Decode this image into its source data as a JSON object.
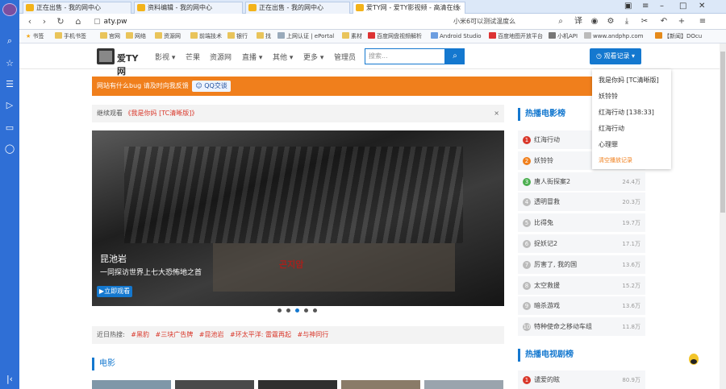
{
  "colors": {
    "accent": "#1478cf",
    "banner": "#f07f1c",
    "hot": "#d9372a"
  },
  "browser": {
    "tabs": [
      {
        "label": "正在出售 - 我的网中心",
        "active": false
      },
      {
        "label": "资料编辑 - 我的网中心",
        "active": false
      },
      {
        "label": "正在出售 - 我的网中心",
        "active": false
      },
      {
        "label": "爱TY网 - 爱TY影视频 - 高清在线",
        "active": true
      }
    ],
    "url": "aty.pw",
    "search": "小米6可以测试温度么",
    "bookmarks": [
      "书签",
      "手机书签",
      "官网",
      "网络",
      "资源网",
      "前端技术",
      "银行",
      "找",
      "上网认证 | ePortal",
      "素材",
      "百度网盘视频解析",
      "Android Studio",
      "百度地图开放平台",
      "小机API",
      "www.andphp.com",
      "【新闻】DOcu"
    ],
    "toolbar_icons": [
      "translate-icon",
      "game-icon",
      "download-icon",
      "scissors-icon",
      "undo-icon",
      "add-icon"
    ]
  },
  "site": {
    "logo_text": "爱TY网",
    "nav": [
      "影视 ▾",
      "芒果",
      "资源网",
      "直播 ▾",
      "其他 ▾",
      "更多 ▾",
      "管理员"
    ],
    "search_placeholder": "搜索...",
    "history_button": "观看记录 ▾",
    "banner_text": "网站有什么bug 请及时向我反馈",
    "banner_qq": "QQ交谈",
    "continue_prefix": "继续观看",
    "continue_title": "《我是你妈 [TC清晰版]》",
    "hero": {
      "title": "昆池岩",
      "desc": "一同探访世界上七大恐怖地之首",
      "play_label": "立即观看",
      "overlay_text": "곤지암"
    },
    "hot_search_label": "近日热搜:",
    "hot_search_tags": [
      "#黑豹",
      "#三块广告牌",
      "#昆池岩",
      "#环太平洋: 雷霆再起",
      "#与神同行"
    ],
    "movie_section": "电影",
    "movie_rank_title": "热播电影榜",
    "movie_rank": [
      {
        "n": "1",
        "name": "红海行动",
        "count": ""
      },
      {
        "n": "2",
        "name": "妖铃铃",
        "count": ""
      },
      {
        "n": "3",
        "name": "唐人街探案2",
        "count": "24.4万"
      },
      {
        "n": "4",
        "name": "透明冒救",
        "count": "20.3万"
      },
      {
        "n": "5",
        "name": "比得兔",
        "count": "19.7万"
      },
      {
        "n": "6",
        "name": "捉妖记2",
        "count": "17.1万"
      },
      {
        "n": "7",
        "name": "厉害了, 我的国",
        "count": "13.6万"
      },
      {
        "n": "8",
        "name": "太空救援",
        "count": "15.2万"
      },
      {
        "n": "9",
        "name": "暗杀游戏",
        "count": "13.6万"
      },
      {
        "n": "10",
        "name": "特种使命之移动车组",
        "count": "11.8万"
      }
    ],
    "tv_rank_title": "热播电视剧榜",
    "tv_rank": [
      {
        "n": "1",
        "name": "谴爱的眩",
        "count": "80.9万"
      }
    ],
    "history_dropdown": [
      "我是你妈 [TC清晰版]",
      "妖铃铃",
      "红海行动 [138:33]",
      "红海行动",
      "心理罪"
    ],
    "history_more": "清空播放记录"
  }
}
